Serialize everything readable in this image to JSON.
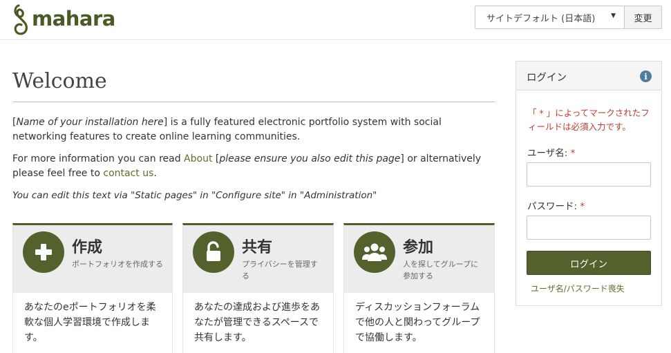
{
  "header": {
    "logo_text": "mahara",
    "language": {
      "selected": "サイトデフォルト (日本語)",
      "change_button": "変更"
    }
  },
  "main": {
    "title": "Welcome",
    "intro": {
      "name_placeholder": "Name of your installation here",
      "bracket_open": "[",
      "bracket_close": "]",
      "text": " is a fully featured electronic portfolio system with social networking features to create online learning communities."
    },
    "more_info": {
      "prefix": "For more information you can read ",
      "about_link": "About",
      "bracket_open": " [",
      "edit_note": "please ensure you also edit this page",
      "middle": "] or alternatively please feel free to ",
      "contact_link": "contact us",
      "suffix": "."
    },
    "edit_hint": "You can edit this text via \"Static pages\" in \"Configure site\" in \"Administration\"",
    "cards": [
      {
        "icon": "plus-icon",
        "title": "作成",
        "subtitle": "ポートフォリオを作成する",
        "body": "あなたのeポートフォリオを柔軟な個人学習環境で作成します。"
      },
      {
        "icon": "unlock-icon",
        "title": "共有",
        "subtitle": "プライバシーを管理する",
        "body": "あなたの達成および進歩をあなたが管理できるスペースで共有します。"
      },
      {
        "icon": "users-icon",
        "title": "参加",
        "subtitle": "人を探してグループに参加する",
        "body": "ディスカッションフォーラムで他の人と関わってグループで協働します。"
      }
    ]
  },
  "login": {
    "title": "ログイン",
    "info_icon": "info-icon",
    "required_note": "「 * 」によってマークされたフィールドは必須入力です。",
    "username_label": "ユーザ名:",
    "password_label": "パスワード:",
    "required_star": "*",
    "username_value": "",
    "password_value": "",
    "submit_label": "ログイン",
    "lost_link": "ユーザ名/パスワード喪失"
  },
  "colors": {
    "brand": "#53622c",
    "link": "#5f6d2b",
    "required": "#c43c31",
    "info": "#4f7ca0"
  }
}
